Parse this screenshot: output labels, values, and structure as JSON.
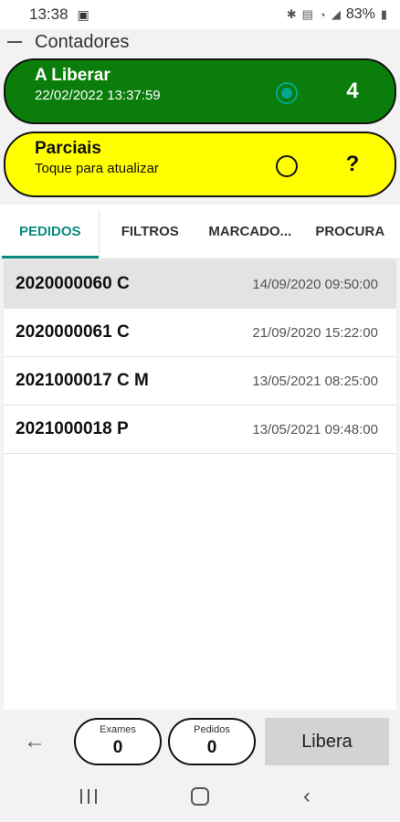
{
  "status_bar": {
    "time": "13:38",
    "battery": "83%",
    "icons": [
      "image-icon",
      "bluetooth-icon",
      "volte-icon",
      "wifi-icon",
      "signal-icon",
      "battery-icon"
    ]
  },
  "header": {
    "title": "Contadores"
  },
  "counters": {
    "liberar": {
      "title": "A Liberar",
      "subtitle": "22/02/2022 13:37:59",
      "count": "4",
      "selected": true,
      "color": "#0a7d0a"
    },
    "parciais": {
      "title": "Parciais",
      "subtitle": "Toque para atualizar",
      "count": "?",
      "selected": false,
      "color": "#ffff00"
    }
  },
  "tabs": [
    {
      "label": "PEDIDOS",
      "active": true
    },
    {
      "label": "FILTROS",
      "active": false
    },
    {
      "label": "MARCADO...",
      "active": false
    },
    {
      "label": "PROCURA",
      "active": false
    }
  ],
  "orders": [
    {
      "id": "2020000060 C",
      "date": "14/09/2020 09:50:00",
      "selected": true
    },
    {
      "id": "2020000061 C",
      "date": "21/09/2020 15:22:00",
      "selected": false
    },
    {
      "id": "2021000017 C M",
      "date": "13/05/2021 08:25:00",
      "selected": false
    },
    {
      "id": "2021000018 P",
      "date": "13/05/2021 09:48:00",
      "selected": false
    }
  ],
  "bottom": {
    "exames_label": "Exames",
    "exames_value": "0",
    "pedidos_label": "Pedidos",
    "pedidos_value": "0",
    "libera_label": "Libera"
  },
  "accent_color": "#0a8a80"
}
